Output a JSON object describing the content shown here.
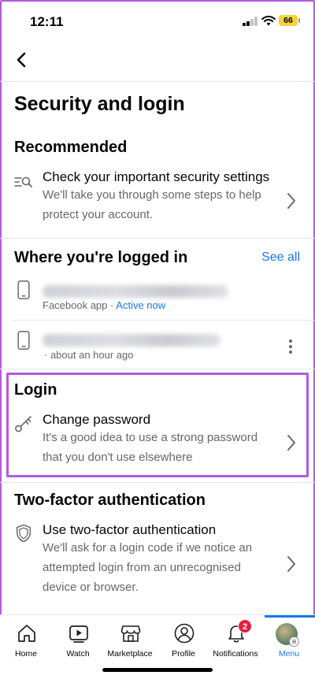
{
  "status": {
    "time": "12:11",
    "battery": "66"
  },
  "page": {
    "title": "Security and login"
  },
  "recommended": {
    "title": "Recommended",
    "item": {
      "title": "Check your important security settings",
      "desc": "We'll take you through some steps to help protect your account."
    }
  },
  "logged_in": {
    "title": "Where you're logged in",
    "see_all": "See all",
    "sessions": [
      {
        "app": "Facebook app",
        "separator": "·",
        "status": "Active now"
      },
      {
        "meta": "· about an hour ago"
      }
    ]
  },
  "login": {
    "title": "Login",
    "item": {
      "title": "Change password",
      "desc": "It's a good idea to use a strong password that you don't use elsewhere"
    }
  },
  "two_factor": {
    "title": "Two-factor authentication",
    "item": {
      "title": "Use two-factor authentication",
      "desc": "We'll ask for a login code if we notice an attempted login from an unrecognised device or browser."
    }
  },
  "tabbar": {
    "tabs": [
      {
        "label": "Home",
        "icon": "home-icon"
      },
      {
        "label": "Watch",
        "icon": "watch-icon"
      },
      {
        "label": "Marketplace",
        "icon": "marketplace-icon"
      },
      {
        "label": "Profile",
        "icon": "profile-icon"
      },
      {
        "label": "Notifications",
        "icon": "bell-icon"
      },
      {
        "label": "Menu",
        "icon": "avatar"
      }
    ],
    "notification_count": "2",
    "active_color": "#1877f2"
  },
  "colors": {
    "highlight": "#b25ae0",
    "link": "#1877f2",
    "badge": "#e41e3f"
  }
}
